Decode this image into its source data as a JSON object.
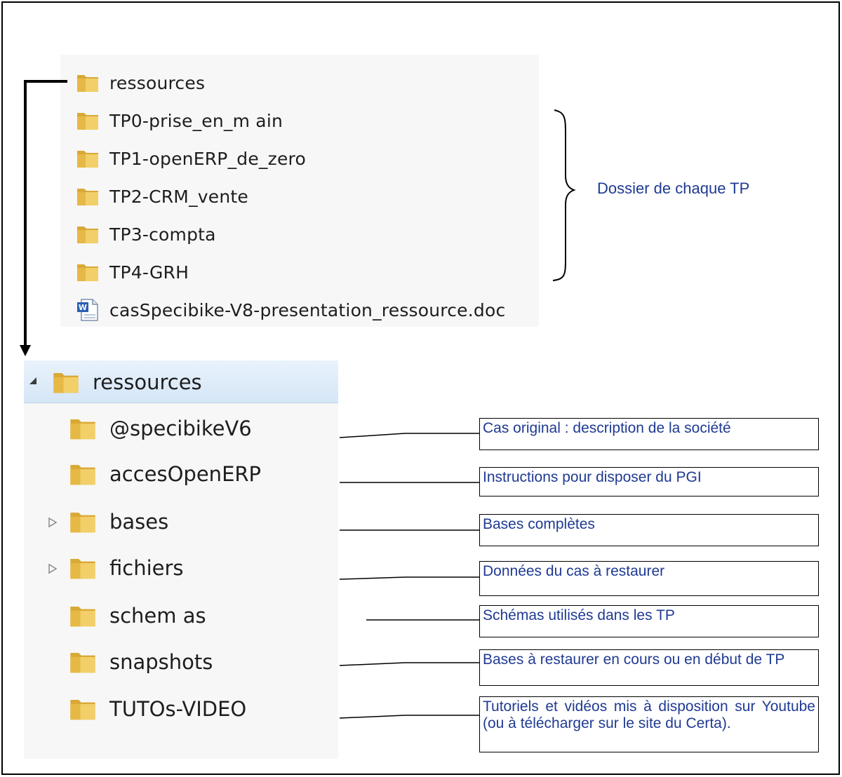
{
  "top_list": {
    "folders": [
      {
        "label": "ressources"
      },
      {
        "label": "TP0-prise_en_m ain"
      },
      {
        "label": "TP1-openERP_de_zero"
      },
      {
        "label": "TP2-CRM_vente"
      },
      {
        "label": "TP3-compta"
      },
      {
        "label": "TP4-GRH"
      }
    ],
    "document": {
      "label": "casSpecibike-V8-presentation_ressource.doc",
      "icon": "word-document-icon"
    }
  },
  "brace_label": "Dossier de chaque TP",
  "tree": {
    "root_label": "ressources",
    "items": [
      {
        "label": "@specibikeV6",
        "expandable": false
      },
      {
        "label": "accesOpenERP",
        "expandable": false
      },
      {
        "label": "bases",
        "expandable": true
      },
      {
        "label": "fichiers",
        "expandable": true
      },
      {
        "label": "schem as",
        "expandable": false
      },
      {
        "label": "snapshots",
        "expandable": false
      },
      {
        "label": "TUTOs-VIDEO",
        "expandable": false
      }
    ]
  },
  "annotations": [
    {
      "text": "Cas original : description de la société"
    },
    {
      "text": "Instructions pour disposer du PGI"
    },
    {
      "text": "Bases complètes"
    },
    {
      "text": "Données du cas à restaurer"
    },
    {
      "text": "Schémas utilisés dans les TP"
    },
    {
      "text": "Bases à restaurer en cours ou en début de TP"
    },
    {
      "text": "Tutoriels et vidéos mis à disposition sur Youtube (ou à télécharger sur le site du Certa)."
    }
  ],
  "colors": {
    "annotation_text": "#1f3a93",
    "folder": "#e8c25a",
    "tree_highlight": "#d5e6f7"
  }
}
